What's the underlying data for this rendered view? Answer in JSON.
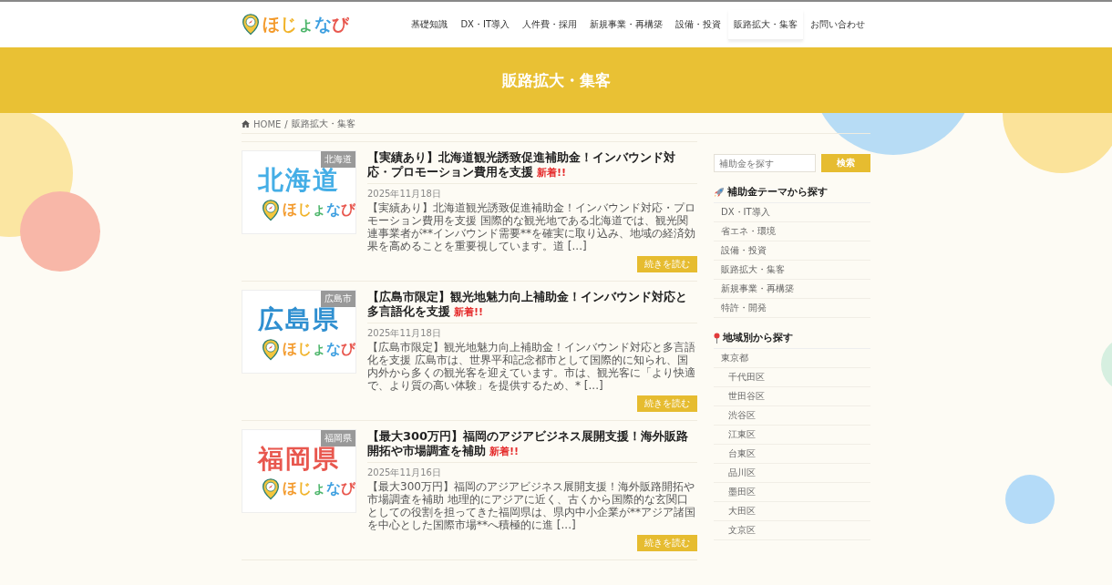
{
  "header": {
    "logo": "ほじょなび",
    "nav": [
      {
        "label": "基礎知識",
        "selected": false
      },
      {
        "label": "DX・IT導入",
        "selected": false
      },
      {
        "label": "人件費・採用",
        "selected": false
      },
      {
        "label": "新規事業・再構築",
        "selected": false
      },
      {
        "label": "設備・投資",
        "selected": false
      },
      {
        "label": "販路拡大・集客",
        "selected": true
      },
      {
        "label": "お問い合わせ",
        "selected": false
      }
    ]
  },
  "page_title": "販路拡大・集客",
  "breadcrumb": {
    "home": "HOME",
    "separator": "/",
    "current": "販路拡大・集客"
  },
  "posts": [
    {
      "thumbnail": {
        "region": "北海道",
        "logo": "ほじょなび",
        "color": "#45aee6"
      },
      "tag": "北海道",
      "title": "【実績あり】北海道観光誘致促進補助金！インバウンド対応・プロモーション費用を支援",
      "new_label": "新着!!",
      "date": "2025年11月18日",
      "excerpt": "【実績あり】北海道観光誘致促進補助金！インバウンド対応・プロモーション費用を支援 国際的な観光地である北海道では、観光関連事業者が**インバウンド需要**を確実に取り込み、地域の経済効果を高めることを重要視しています。道 [...]",
      "button": "続きを読む"
    },
    {
      "thumbnail": {
        "region": "広島県",
        "logo": "ほじょなび",
        "color": "#2f8fd0"
      },
      "tag": "広島市",
      "title": "【広島市限定】観光地魅力向上補助金！インバウンド対応と多言語化を支援",
      "new_label": "新着!!",
      "date": "2025年11月18日",
      "excerpt": "【広島市限定】観光地魅力向上補助金！インバウンド対応と多言語化を支援 広島市は、世界平和記念都市として国際的に知られ、国内外から多くの観光客を迎えています。市は、観光客に「より快適で、より質の高い体験」を提供するため、* [...]",
      "button": "続きを読む"
    },
    {
      "thumbnail": {
        "region": "福岡県",
        "logo": "ほじょなび",
        "color": "#e8574e"
      },
      "tag": "福岡県",
      "title": "【最大300万円】福岡のアジアビジネス展開支援！海外販路開拓や市場調査を補助",
      "new_label": "新着!!",
      "date": "2025年11月16日",
      "excerpt": "【最大300万円】福岡のアジアビジネス展開支援！海外販路開拓や市場調査を補助 地理的にアジアに近く、古くから国際的な玄関口としての役割を担ってきた福岡県は、県内中小企業が**アジア諸国を中心とした国際市場**へ積極的に進 [...]",
      "button": "続きを読む"
    }
  ],
  "sidebar": {
    "search": {
      "placeholder": "補助金を探す",
      "button": "検索"
    },
    "theme_heading": "補助金テーマから探す",
    "themes": [
      {
        "label": "DX・IT導入"
      },
      {
        "label": "省エネ・環境"
      },
      {
        "label": "設備・投資"
      },
      {
        "label": "販路拡大・集客"
      },
      {
        "label": "新規事業・再構築"
      },
      {
        "label": "特許・開発"
      }
    ],
    "region_heading": "地域別から探す",
    "regions": [
      {
        "label": "東京都",
        "children": [
          {
            "label": "千代田区"
          },
          {
            "label": "世田谷区"
          },
          {
            "label": "渋谷区"
          },
          {
            "label": "江東区"
          },
          {
            "label": "台東区"
          },
          {
            "label": "品川区"
          },
          {
            "label": "墨田区"
          },
          {
            "label": "大田区"
          },
          {
            "label": "文京区"
          }
        ]
      }
    ]
  }
}
